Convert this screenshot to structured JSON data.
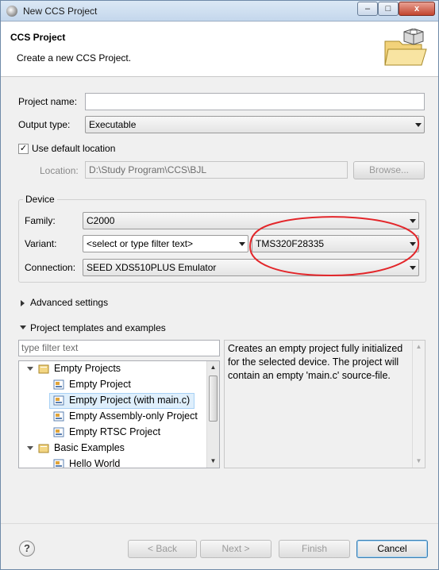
{
  "window": {
    "title": "New CCS Project",
    "controls": {
      "minimize": "–",
      "maximize": "□",
      "close": "x"
    }
  },
  "header": {
    "title": "CCS Project",
    "description": "Create a new CCS Project."
  },
  "form": {
    "project_name_label": "Project name:",
    "project_name_value": "",
    "output_type_label": "Output type:",
    "output_type_value": "Executable",
    "use_default_location_label": "Use default location",
    "use_default_location_checked": true,
    "location_label": "Location:",
    "location_value": "D:\\Study Program\\CCS\\BJL",
    "browse_label": "Browse..."
  },
  "device": {
    "group_title": "Device",
    "family_label": "Family:",
    "family_value": "C2000",
    "variant_label": "Variant:",
    "variant_filter_placeholder": "<select or type filter text>",
    "variant_value": "TMS320F28335",
    "connection_label": "Connection:",
    "connection_value": "SEED XDS510PLUS Emulator",
    "highlight_color": "#e3262a"
  },
  "advanced": {
    "label": "Advanced settings",
    "expanded": false
  },
  "templates": {
    "label": "Project templates and examples",
    "expanded": true,
    "filter_placeholder": "type filter text",
    "tree": [
      {
        "label": "Empty Projects",
        "level": 0,
        "expanded": true,
        "icon": "folder-icon"
      },
      {
        "label": "Empty Project",
        "level": 1,
        "icon": "template-icon"
      },
      {
        "label": "Empty Project (with main.c)",
        "level": 1,
        "icon": "template-icon",
        "selected": true
      },
      {
        "label": "Empty Assembly-only Project",
        "level": 1,
        "icon": "template-icon"
      },
      {
        "label": "Empty RTSC Project",
        "level": 1,
        "icon": "template-icon"
      },
      {
        "label": "Basic Examples",
        "level": 0,
        "expanded": true,
        "icon": "folder-icon"
      },
      {
        "label": "Hello World",
        "level": 1,
        "icon": "template-icon"
      }
    ],
    "description": "Creates an empty project fully initialized for the selected device. The project will contain an empty 'main.c' source-file."
  },
  "buttons": {
    "back": "< Back",
    "next": "Next >",
    "finish": "Finish",
    "cancel": "Cancel"
  },
  "help": {
    "icon": "help-icon",
    "glyph": "?"
  }
}
